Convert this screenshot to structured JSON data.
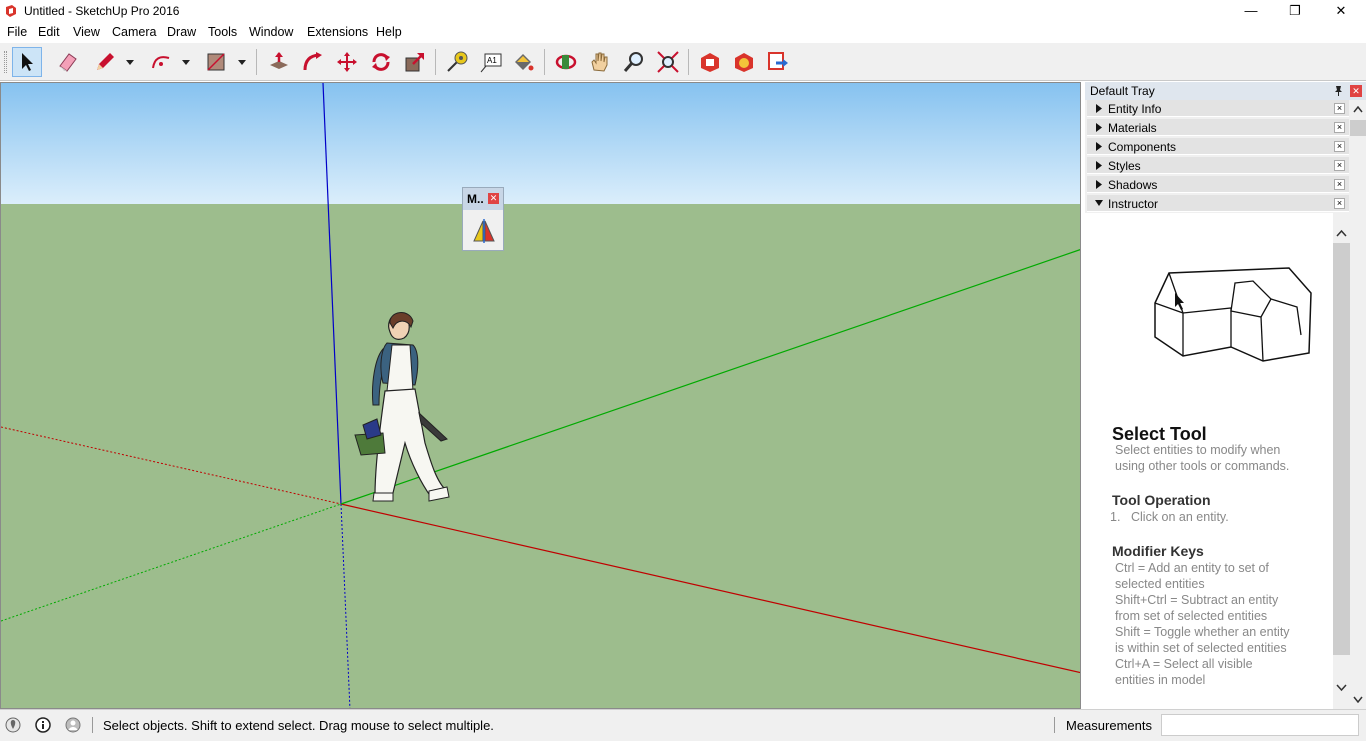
{
  "window": {
    "title": "Untitled - SketchUp Pro 2016",
    "minimize_glyph": "—",
    "restore_glyph": "❐",
    "close_glyph": "✕"
  },
  "menu": [
    "File",
    "Edit",
    "View",
    "Camera",
    "Draw",
    "Tools",
    "Window",
    "Extensions",
    "Help"
  ],
  "toolbar": {
    "tools": [
      "select-icon",
      "eraser-icon",
      "pencil-icon",
      "arc-icon",
      "rectangle-icon",
      "push-pull-icon",
      "follow-me-icon",
      "move-icon",
      "rotate-icon",
      "scale-icon",
      "tape-measure-icon",
      "text-icon",
      "paint-bucket-icon",
      "orbit-icon",
      "pan-icon",
      "zoom-icon",
      "zoom-extents-icon",
      "warehouse-icon",
      "extension-warehouse-icon",
      "layout-icon"
    ],
    "text_tool_glyph": "A1"
  },
  "floating_window": {
    "title": "M..",
    "close_glyph": "✕",
    "icon": "mirror-icon"
  },
  "tray": {
    "title": "Default Tray",
    "pin_glyph": "📌",
    "close_glyph": "✕",
    "panels": [
      {
        "label": "Entity Info",
        "expanded": false
      },
      {
        "label": "Materials",
        "expanded": false
      },
      {
        "label": "Components",
        "expanded": false
      },
      {
        "label": "Styles",
        "expanded": false
      },
      {
        "label": "Shadows",
        "expanded": false
      },
      {
        "label": "Instructor",
        "expanded": true
      }
    ],
    "panel_close_glyph": "×",
    "instructor": {
      "heading": "Select Tool",
      "intro_1": "Select entities to modify when",
      "intro_2": "using other tools or commands.",
      "operation_heading": "Tool Operation",
      "operation_num": "1.",
      "operation_step": "Click on an entity.",
      "modifier_heading": "Modifier Keys",
      "modifier_lines": [
        "Ctrl = Add an entity to set of",
        "selected entities",
        "Shift+Ctrl = Subtract an entity",
        "from set of selected entities",
        "Shift = Toggle whether an entity",
        "is within set of selected entities",
        "Ctrl+A = Select all visible",
        "entities in model"
      ]
    }
  },
  "status": {
    "hint": "Select objects. Shift to extend select. Drag mouse to select multiple.",
    "measurements_label": "Measurements",
    "measurements_value": ""
  },
  "colors": {
    "sky_top": "#86c2f0",
    "sky_bottom": "#dbeefb",
    "ground": "#9dbd8d",
    "axis_red": "#c00000",
    "axis_green": "#00aa00",
    "axis_blue": "#0000c8"
  }
}
